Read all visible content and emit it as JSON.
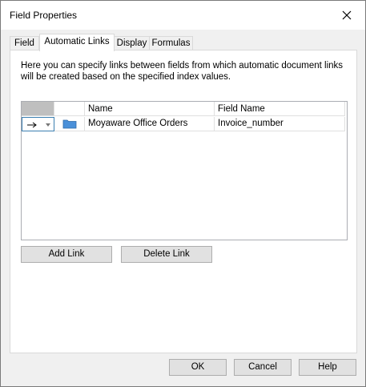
{
  "window": {
    "title": "Field Properties"
  },
  "tabs": [
    {
      "label": "Field",
      "active": false
    },
    {
      "label": "Automatic Links",
      "active": true
    },
    {
      "label": "Display",
      "active": false
    },
    {
      "label": "Formulas",
      "active": false
    }
  ],
  "panel": {
    "description": "Here you can specify links between fields from which automatic document links will be created based on the specified index values."
  },
  "grid": {
    "columns": [
      "",
      "",
      "Name",
      "Field Name"
    ],
    "rows": [
      {
        "link_icon": "arrow-right-icon",
        "type_icon": "folder-icon",
        "name": "Moyaware Office Orders",
        "field_name": "Invoice_number"
      }
    ]
  },
  "actions": {
    "add_link": "Add Link",
    "delete_link": "Delete Link"
  },
  "footer": {
    "ok": "OK",
    "cancel": "Cancel",
    "help": "Help"
  },
  "colors": {
    "folder": "#4a90d9",
    "selected_header": "#bfbfbf",
    "accent_border": "#3c7fb1"
  }
}
